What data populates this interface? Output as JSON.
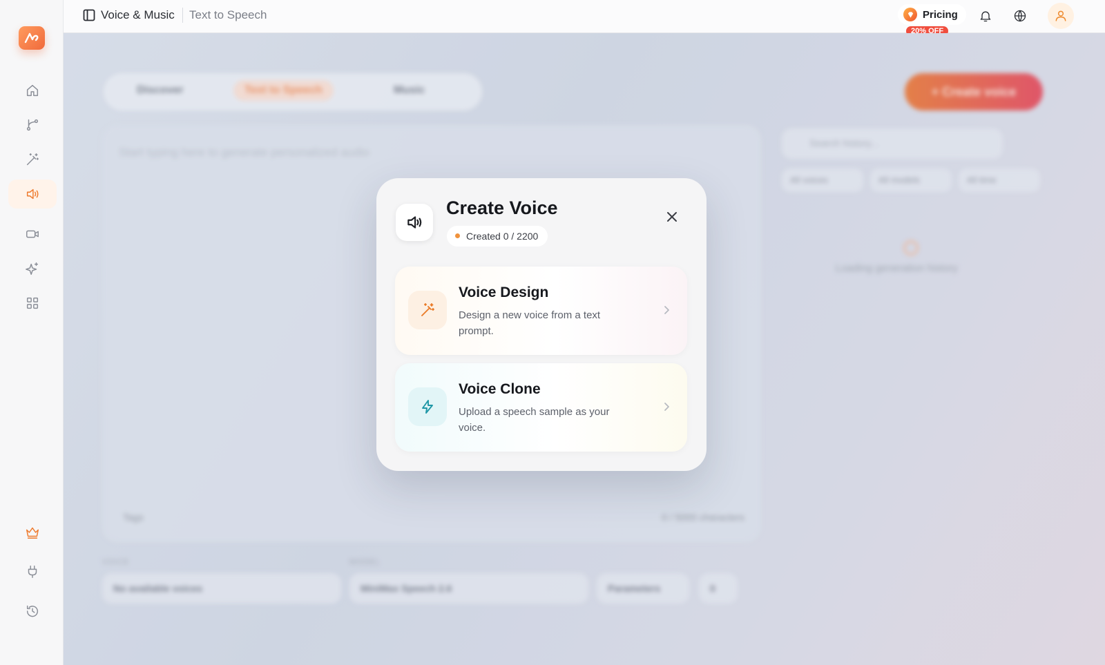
{
  "app": {
    "section": "Voice & Music",
    "page": "Text to Speech"
  },
  "sidebar": {
    "items": [
      {
        "name": "home",
        "icon": "home-icon"
      },
      {
        "name": "workflow",
        "icon": "branch-icon"
      },
      {
        "name": "magic",
        "icon": "magic-wand-icon"
      },
      {
        "name": "voice",
        "icon": "speaker-icon",
        "active": true
      },
      {
        "name": "video",
        "icon": "video-icon"
      },
      {
        "name": "ai",
        "icon": "sparkles-icon"
      },
      {
        "name": "apps",
        "icon": "grid-icon"
      },
      {
        "name": "premium",
        "icon": "crown-icon"
      },
      {
        "name": "plugins",
        "icon": "plug-icon"
      },
      {
        "name": "history",
        "icon": "history-icon"
      }
    ]
  },
  "header": {
    "pricing_label": "Pricing",
    "discount_label": "20% OFF"
  },
  "background": {
    "tabs": [
      "Discover",
      "Text to Speech",
      "Music"
    ],
    "active_tab": "Text to Speech",
    "create_button": "+ Create voice",
    "editor_placeholder": "Start typing here to generate personalized audio",
    "tags_label": "Tags",
    "char_count": "0 / 5000 characters",
    "search_placeholder": "Search history...",
    "filters": [
      "All voices",
      "All models",
      "All time"
    ],
    "loading_text": "Loading generation history",
    "voice_label": "VOICE",
    "voice_value": "No available voices",
    "model_label": "MODEL",
    "model_value": "MiniMax Speech 2.6",
    "parameters_label": "Parameters",
    "credits_value": "0"
  },
  "modal": {
    "title": "Create Voice",
    "badge": "Created 0 / 2200",
    "options": [
      {
        "title": "Voice Design",
        "description": "Design a new voice from a text prompt.",
        "icon": "magic-wand-icon",
        "accent": "#ea7b28"
      },
      {
        "title": "Voice Clone",
        "description": "Upload a speech sample as your voice.",
        "icon": "lightning-icon",
        "accent": "#1e97a6"
      }
    ]
  },
  "colors": {
    "accent": "#ee7a2d",
    "discount": "#f04e3e",
    "clone_accent": "#1e97a6"
  }
}
